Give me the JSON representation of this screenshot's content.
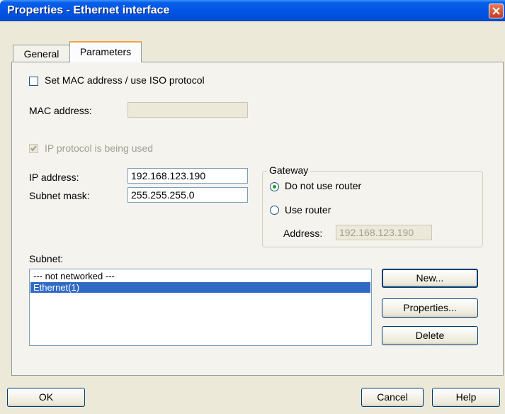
{
  "window": {
    "title": "Properties - Ethernet interface"
  },
  "tabs": [
    {
      "label": "General"
    },
    {
      "label": "Parameters"
    }
  ],
  "mac": {
    "checkbox_label": "Set MAC address / use ISO protocol",
    "address_label": "MAC address:",
    "address_value": ""
  },
  "ip": {
    "protocol_label": "IP protocol is being used",
    "address_label": "IP address:",
    "address_value": "192.168.123.190",
    "subnet_label": "Subnet mask:",
    "subnet_value": "255.255.255.0"
  },
  "gateway": {
    "legend": "Gateway",
    "option_no_router": "Do not use router",
    "option_use_router": "Use router",
    "address_label": "Address:",
    "address_value": "192.168.123.190"
  },
  "subnet": {
    "label": "Subnet:",
    "items": [
      "--- not networked ---",
      "Ethernet(1)"
    ],
    "new_button": "New...",
    "properties_button": "Properties...",
    "delete_button": "Delete"
  },
  "footer": {
    "ok": "OK",
    "cancel": "Cancel",
    "help": "Help"
  },
  "colors": {
    "titlebar": "#0055e5",
    "selection": "#316ac5",
    "dialog_bg": "#ece9d8"
  }
}
